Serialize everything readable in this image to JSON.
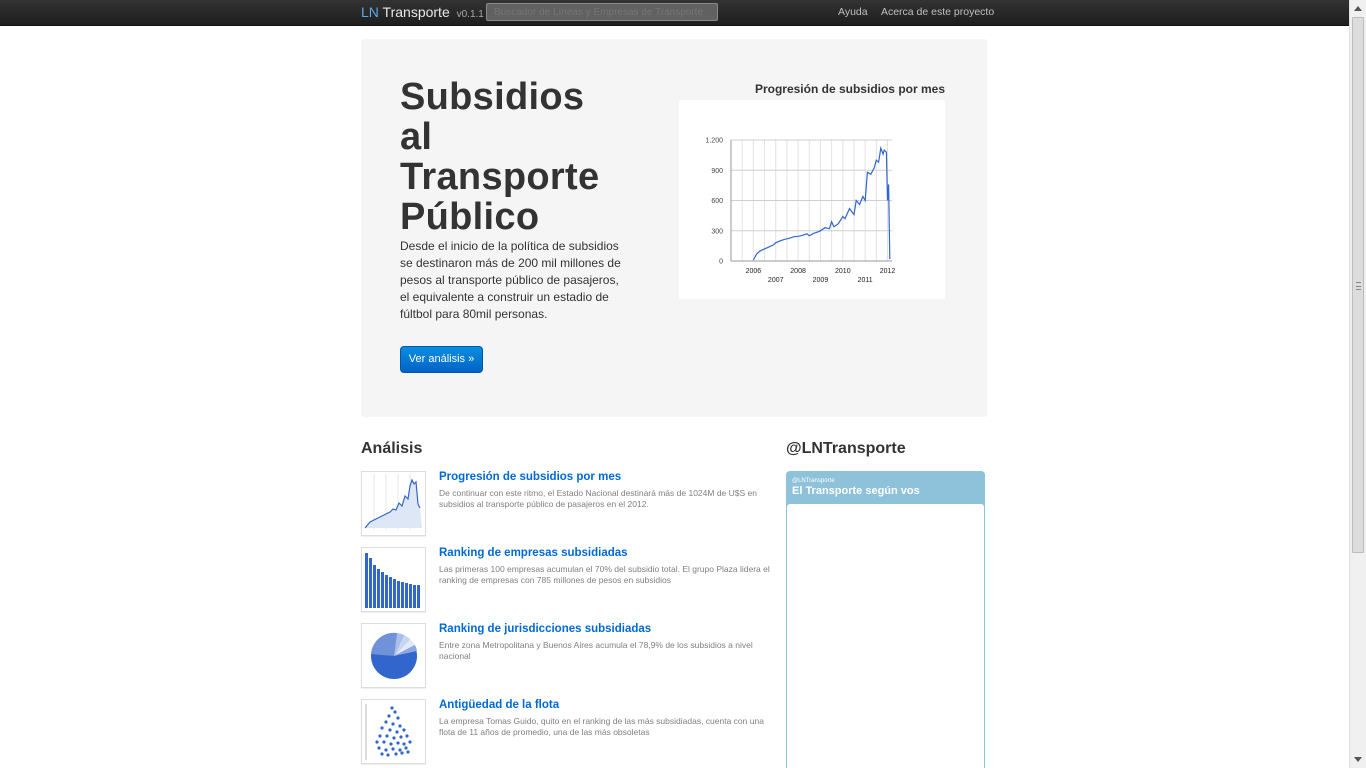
{
  "navbar": {
    "brand_ln": "LN",
    "brand_name": "Transporte",
    "version": "v0.1.1",
    "search_placeholder": "Buscador de Líneas y Empresas de Transporte",
    "links": [
      "Ayuda",
      "Acerca de este proyecto"
    ]
  },
  "hero": {
    "title": "Subsidios al Transporte Público",
    "description": "Desde el inicio de la política de subsidios se destinaron más de 200 mil millones de pesos al transporte público de pasajeros, el equivalente a construir un estadio de fúltbol para 80mil personas.",
    "button_label": "Ver análisis »",
    "chart_title": "Progresión de subsidios por mes"
  },
  "analysis": {
    "heading": "Análisis",
    "items": [
      {
        "title": "Progresión de subsidios por mes",
        "description": "De continuar con este ritmo, el Estado Nacional destinará más de 1024M de U$S en subsidios al transporte público de pasajeros en el 2012.",
        "thumb": "line-chart-thumbnail"
      },
      {
        "title": "Ranking de empresas subsidiadas",
        "description": "Las primeras 100 empresas acumulan el 70% del subsidio total. El grupo Plaza lidera el ranking de empresas con 785 millones de pesos en subsidios",
        "thumb": "bar-chart-thumbnail"
      },
      {
        "title": "Ranking de jurisdicciones subsidiadas",
        "description": "Entre zona Metropolitana y Buenos Aires acumula el 78,9% de los subsidios a nivel nacional",
        "thumb": "pie-chart-thumbnail"
      },
      {
        "title": "Antigüedad de la flota",
        "description": "La empresa Tomas Guido, quito en el ranking de las más subsidiadas, cuenta con una flota de 11 años de promedio, una de las más obsoletas",
        "thumb": "scatter-chart-thumbnail"
      }
    ]
  },
  "twitter": {
    "heading": "@LNTransporte",
    "handle": "@LNTransporte",
    "widget_title": "El Transporte según vos",
    "header_color": "#8ec1da"
  },
  "colors": {
    "accent": "#0069d6",
    "line": "#3366cc",
    "navbar": "#222222"
  },
  "chart_data": {
    "type": "line",
    "title": "Progresión de subsidios por mes",
    "xlabel": "",
    "ylabel": "",
    "ylim": [
      0,
      1200
    ],
    "yticks": [
      0,
      300,
      600,
      900,
      1200
    ],
    "ytick_labels": [
      "0",
      "300",
      "600",
      "900",
      "1.200"
    ],
    "xlim": [
      2005.0,
      2012.2
    ],
    "xticks_upper": [
      "2006",
      "2008",
      "2010",
      "2012"
    ],
    "xticks_lower": [
      "2007",
      "2009",
      "2011"
    ],
    "grid": true,
    "series": [
      {
        "name": "",
        "x": [
          2006.0,
          2006.15,
          2006.3,
          2006.5,
          2006.7,
          2006.9,
          2007.0,
          2007.2,
          2007.4,
          2007.6,
          2007.8,
          2008.0,
          2008.2,
          2008.4,
          2008.5,
          2008.7,
          2008.9,
          2009.0,
          2009.2,
          2009.4,
          2009.5,
          2009.6,
          2009.8,
          2010.0,
          2010.1,
          2010.3,
          2010.5,
          2010.6,
          2010.75,
          2010.9,
          2011.0,
          2011.1,
          2011.25,
          2011.4,
          2011.5,
          2011.6,
          2011.7,
          2011.8,
          2011.85,
          2011.95,
          2012.0,
          2012.05,
          2012.1
        ],
        "values": [
          10,
          70,
          100,
          120,
          140,
          160,
          180,
          200,
          215,
          225,
          240,
          245,
          255,
          270,
          250,
          275,
          290,
          300,
          330,
          320,
          390,
          340,
          370,
          440,
          420,
          520,
          460,
          600,
          560,
          640,
          600,
          880,
          860,
          920,
          1000,
          980,
          1120,
          1060,
          1100,
          1080,
          600,
          760,
          20
        ]
      }
    ]
  }
}
